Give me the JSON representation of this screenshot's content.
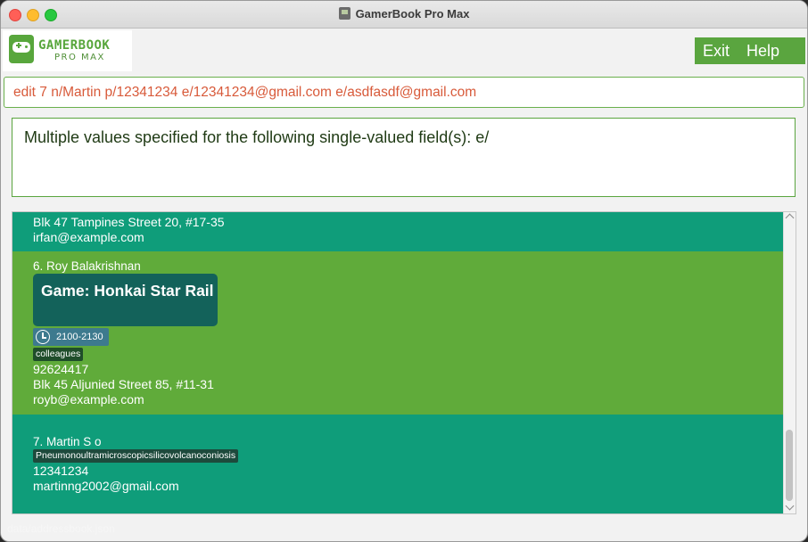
{
  "window": {
    "title": "GamerBook Pro Max"
  },
  "logo": {
    "line1": "GAMERBOOK",
    "line2": "PRO MAX"
  },
  "menu": {
    "exit": "Exit",
    "help": "Help"
  },
  "command_box": {
    "value": "edit 7 n/Martin p/12341234 e/12341234@gmail.com e/asdfasdf@gmail.com"
  },
  "result_display": {
    "text": "Multiple values specified for the following single-valued field(s): e/"
  },
  "persons": [
    {
      "address": "Blk 47 Tampines Street 20, #17-35",
      "email": "irfan@example.com"
    },
    {
      "name": "6. Roy Balakrishnan",
      "game": "Game: Honkai Star Rail",
      "time": "2100-2130",
      "tag": "colleagues",
      "phone": "92624417",
      "address": "Blk 45 Aljunied Street 85, #11-31",
      "email": "royb@example.com"
    },
    {
      "name": "7. Martin S o",
      "tag": "Pneumonoultramicroscopicsilicovolcanoconiosis",
      "phone": "12341234",
      "email": "martinng2002@gmail.com"
    }
  ],
  "status_bar": {
    "path": "data/addressbook.json"
  },
  "colors": {
    "accent": "#5aa53f",
    "card_teal": "#0f9d7a",
    "card_green": "#60ab3a",
    "error_text": "#d85a3a"
  },
  "icons": [
    "app-icon",
    "controller-logo-icon",
    "clock-icon"
  ]
}
